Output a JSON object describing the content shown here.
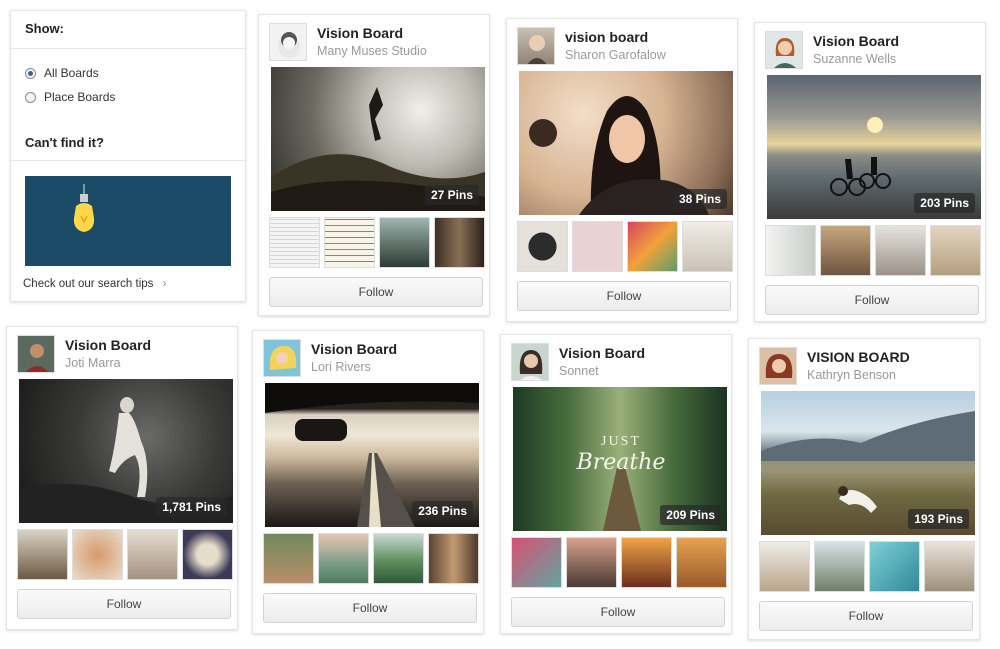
{
  "filter": {
    "heading": "Show:",
    "options": [
      {
        "label": "All Boards",
        "selected": true
      },
      {
        "label": "Place Boards",
        "selected": false
      }
    ],
    "cant_find": "Can't find it?",
    "tips_link": "Check out our search tips",
    "tips_arrow": "›",
    "banner_color": "#1a4a66"
  },
  "follow_label": "Follow",
  "boards": [
    {
      "title": "Vision Board",
      "author": "Many Muses Studio",
      "pins": "27 Pins"
    },
    {
      "title": "vision board",
      "author": "Sharon Garofalow",
      "pins": "38 Pins"
    },
    {
      "title": "Vision Board",
      "author": "Suzanne Wells",
      "pins": "203 Pins"
    },
    {
      "title": "Vision Board",
      "author": "Joti Marra",
      "pins": "1,781 Pins"
    },
    {
      "title": "Vision Board",
      "author": "Lori Rivers",
      "pins": "236 Pins"
    },
    {
      "title": "Vision Board",
      "author": "Sonnet",
      "pins": "209 Pins",
      "cover_text": [
        "JUST",
        "Breathe"
      ]
    },
    {
      "title": "VISION BOARD",
      "author": "Kathryn Benson",
      "pins": "193 Pins"
    }
  ]
}
